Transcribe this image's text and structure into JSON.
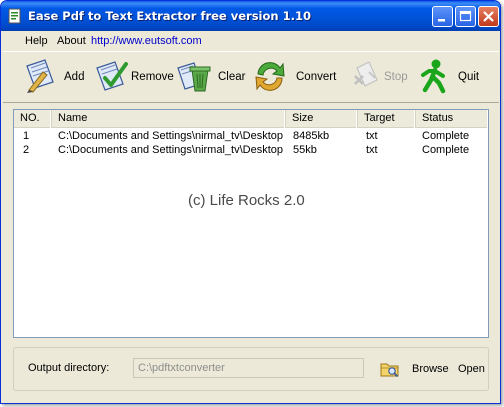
{
  "window": {
    "title": "Ease Pdf to Text Extractor free version 1.10"
  },
  "menu": {
    "help": "Help",
    "about": "About",
    "link": "http://www.eutsoft.com"
  },
  "toolbar": {
    "add": "Add",
    "remove": "Remove",
    "clear": "Clear",
    "convert": "Convert",
    "stop": "Stop",
    "quit": "Quit",
    "icons": [
      "add-icon",
      "remove-icon",
      "clear-icon",
      "convert-icon",
      "stop-icon",
      "quit-icon"
    ]
  },
  "list": {
    "columns": [
      "NO.",
      "Name",
      "Size",
      "Target",
      "Status"
    ],
    "rows": [
      {
        "no": "1",
        "name": "C:\\Documents and Settings\\nirmal_tv\\Desktop...",
        "size": "8485kb",
        "target": "txt",
        "status": "Complete"
      },
      {
        "no": "2",
        "name": "C:\\Documents and Settings\\nirmal_tv\\Desktop...",
        "size": "55kb",
        "target": "txt",
        "status": "Complete"
      }
    ],
    "watermark": "(c) Life Rocks 2.0"
  },
  "output": {
    "label": "Output directory:",
    "value": "C:\\pdftxtconverter",
    "browse": "Browse",
    "open": "Open"
  },
  "colors": {
    "titlebar": "#0052d6",
    "window_face": "#ece9d8",
    "link": "#0000cc"
  }
}
